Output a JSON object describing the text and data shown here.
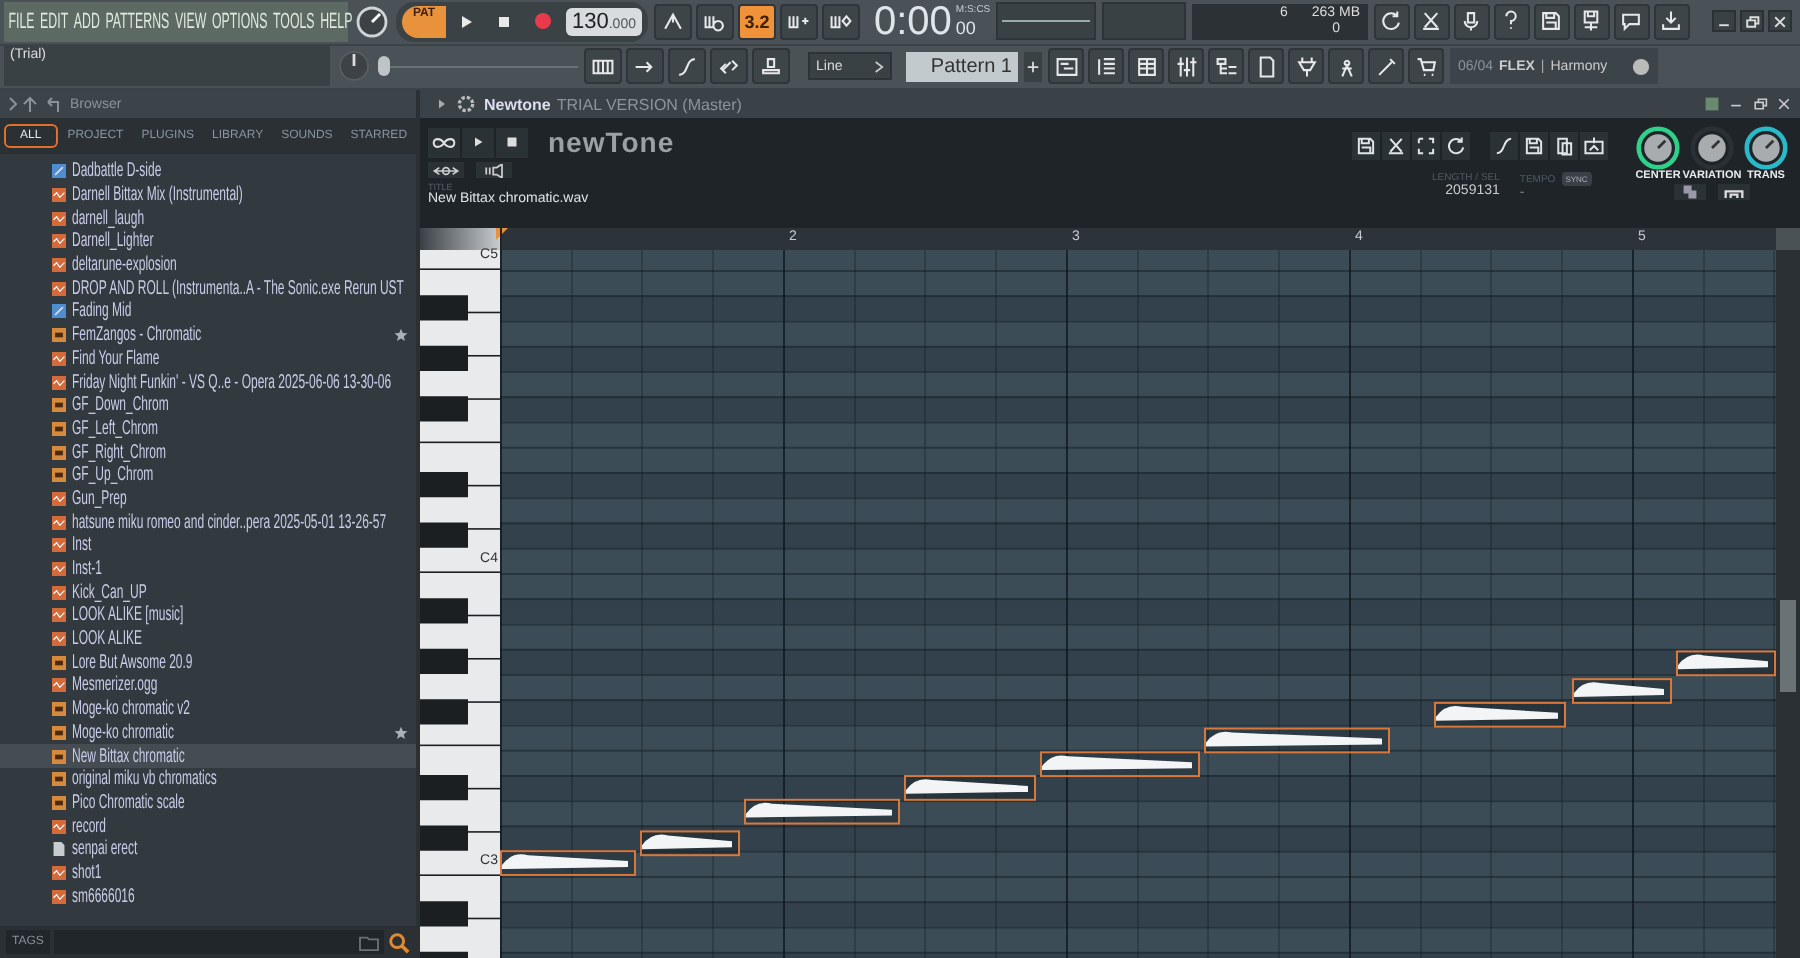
{
  "menu": [
    "FILE",
    "EDIT",
    "ADD",
    "PATTERNS",
    "VIEW",
    "OPTIONS",
    "TOOLS",
    "HELP"
  ],
  "hint": "(Trial)",
  "transport": {
    "mode": "PAT",
    "tempo": "130",
    "tempo_fraction": ".000"
  },
  "countdown": {
    "label": "3.2",
    "on": true
  },
  "time": {
    "main": "0:00",
    "unit": "M:S:CS",
    "fraction": "00"
  },
  "cpu": {
    "polyphony": "6",
    "memory": "263 MB",
    "value": "0"
  },
  "snap": "Line",
  "pattern": "Pattern 1",
  "pitch_slider": {
    "level": 0
  },
  "panel_hint": {
    "count": "06/04",
    "brand": "FLEX",
    "separator": "|",
    "preset": "Harmony"
  },
  "browser": {
    "title": "Browser",
    "tabs": [
      {
        "label": "ALL",
        "selected": true
      },
      {
        "label": "PROJECT",
        "selected": false
      },
      {
        "label": "PLUGINS",
        "selected": false
      },
      {
        "label": "LIBRARY",
        "selected": false
      },
      {
        "label": "SOUNDS",
        "selected": false
      },
      {
        "label": "STARRED",
        "selected": false
      }
    ],
    "items": [
      {
        "name": "Dadbattle D-side",
        "kind": "score",
        "starred": false,
        "selected": false
      },
      {
        "name": "Darnell Bittax Mix (Instrumental)",
        "kind": "audio",
        "starred": false,
        "selected": false
      },
      {
        "name": "darnell_laugh",
        "kind": "audio",
        "starred": false,
        "selected": false
      },
      {
        "name": "Darnell_Lighter",
        "kind": "audio",
        "starred": false,
        "selected": false
      },
      {
        "name": "deltarune-explosion",
        "kind": "audio",
        "starred": false,
        "selected": false
      },
      {
        "name": "DROP AND ROLL (Instrumenta..A - The Sonic.exe Rerun UST",
        "kind": "audio",
        "starred": false,
        "selected": false
      },
      {
        "name": "Fading Mid",
        "kind": "score",
        "starred": false,
        "selected": false
      },
      {
        "name": "FemZangos - Chromatic",
        "kind": "pattern",
        "starred": true,
        "selected": false
      },
      {
        "name": "Find Your Flame",
        "kind": "audio",
        "starred": false,
        "selected": false
      },
      {
        "name": "Friday Night Funkin' - VS Q..e - Opera 2025-06-06 13-30-06",
        "kind": "audio",
        "starred": false,
        "selected": false
      },
      {
        "name": "GF_Down_Chrom",
        "kind": "pattern",
        "starred": false,
        "selected": false
      },
      {
        "name": "GF_Left_Chrom",
        "kind": "pattern",
        "starred": false,
        "selected": false
      },
      {
        "name": "GF_Right_Chrom",
        "kind": "pattern",
        "starred": false,
        "selected": false
      },
      {
        "name": "GF_Up_Chrom",
        "kind": "pattern",
        "starred": false,
        "selected": false
      },
      {
        "name": "Gun_Prep",
        "kind": "audio",
        "starred": false,
        "selected": false
      },
      {
        "name": "hatsune miku romeo and cinder..pera 2025-05-01 13-26-57",
        "kind": "audio",
        "starred": false,
        "selected": false
      },
      {
        "name": "Inst",
        "kind": "audio",
        "starred": false,
        "selected": false
      },
      {
        "name": "Inst-1",
        "kind": "audio",
        "starred": false,
        "selected": false
      },
      {
        "name": "Kick_Can_UP",
        "kind": "audio",
        "starred": false,
        "selected": false
      },
      {
        "name": "LOOK ALIKE [music]",
        "kind": "audio",
        "starred": false,
        "selected": false
      },
      {
        "name": "LOOK ALIKE",
        "kind": "audio",
        "starred": false,
        "selected": false
      },
      {
        "name": "Lore But Awsome 20.9",
        "kind": "pattern",
        "starred": false,
        "selected": false
      },
      {
        "name": "Mesmerizer.ogg",
        "kind": "audio",
        "starred": false,
        "selected": false
      },
      {
        "name": "Moge-ko chromatic v2",
        "kind": "pattern",
        "starred": false,
        "selected": false
      },
      {
        "name": "Moge-ko chromatic",
        "kind": "pattern",
        "starred": true,
        "selected": false
      },
      {
        "name": "New Bittax chromatic",
        "kind": "pattern",
        "starred": false,
        "selected": true
      },
      {
        "name": "original miku vb chromatics",
        "kind": "pattern",
        "starred": false,
        "selected": false
      },
      {
        "name": "Pico Chromatic scale",
        "kind": "pattern",
        "starred": false,
        "selected": false
      },
      {
        "name": "record",
        "kind": "audio",
        "starred": false,
        "selected": false
      },
      {
        "name": "senpai erect",
        "kind": "document",
        "starred": false,
        "selected": false
      },
      {
        "name": "shot1",
        "kind": "audio",
        "starred": false,
        "selected": false
      },
      {
        "name": "sm6666016",
        "kind": "audio",
        "starred": false,
        "selected": false
      }
    ],
    "tags_label": "TAGS"
  },
  "plugin": {
    "name": "Newtone",
    "subtitle": "TRIAL VERSION (Master)",
    "logo": "newTone",
    "title_label": "TITLE",
    "file": "New Bittax chromatic.wav",
    "length_label": "LENGTH / SEL",
    "length": "2059131",
    "tempo_label": "TEMPO",
    "tempo": "-",
    "sync": "SYNC",
    "knobs": [
      {
        "label": "CENTER",
        "color": "#2fd08a"
      },
      {
        "label": "VARIATION",
        "color": "#2a3136"
      },
      {
        "label": "TRANS",
        "color": "#2bb9c9"
      }
    ],
    "bars": [
      "2",
      "3",
      "4",
      "5"
    ],
    "keys": [
      "C5",
      "C4",
      "C3"
    ]
  }
}
